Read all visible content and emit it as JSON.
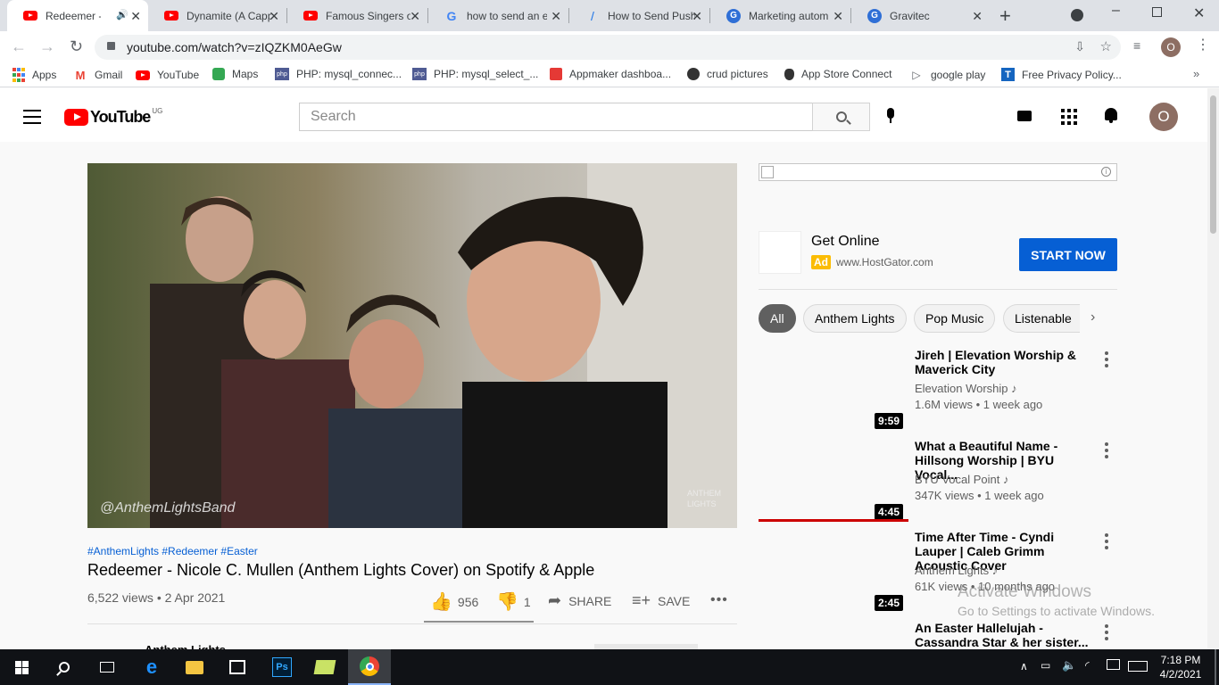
{
  "browser": {
    "tabs": [
      {
        "title": "Redeemer - Nicole C. Mullen",
        "icon": "youtube-icon",
        "active": true
      },
      {
        "title": "Dynamite (A Cappella)",
        "icon": "youtube-icon"
      },
      {
        "title": "Famous Singers of",
        "icon": "youtube-icon"
      },
      {
        "title": "how to send an e",
        "icon": "google-icon"
      },
      {
        "title": "How to Send Push",
        "icon": "page-icon"
      },
      {
        "title": "Marketing autom",
        "icon": "gravitec-icon"
      },
      {
        "title": "Gravitec",
        "icon": "gravitec-icon"
      }
    ],
    "url": "youtube.com/watch?v=zIQZKM0AeGw",
    "profile_initial": "O",
    "bookmarks": [
      {
        "label": "Apps",
        "icon": "apps-icon"
      },
      {
        "label": "Gmail",
        "icon": "gmail-icon"
      },
      {
        "label": "YouTube",
        "icon": "youtube-icon"
      },
      {
        "label": "Maps",
        "icon": "maps-icon"
      },
      {
        "label": "PHP: mysql_connec...",
        "icon": "php-icon"
      },
      {
        "label": "PHP: mysql_select_...",
        "icon": "php-icon"
      },
      {
        "label": "Appmaker dashboa...",
        "icon": "appmaker-icon"
      },
      {
        "label": "crud pictures",
        "icon": "crud-icon"
      },
      {
        "label": "App Store Connect",
        "icon": "apple-icon"
      },
      {
        "label": "google play",
        "icon": "play-icon"
      },
      {
        "label": "Free Privacy Policy...",
        "icon": "termly-icon"
      }
    ]
  },
  "youtube": {
    "logo_text": "YouTube",
    "country": "UG",
    "search_placeholder": "Search",
    "avatar_initial": "O",
    "video": {
      "watermark": "@AnthemLightsBand",
      "corner_logo": "ANTHEM LIGHTS",
      "hashtags": "#AnthemLights #Redeemer #Easter",
      "title": "Redeemer - Nicole C. Mullen (Anthem Lights Cover) on Spotify & Apple",
      "views_date": "6,522 views • 2 Apr 2021",
      "likes": "956",
      "dislikes": "1",
      "share_label": "SHARE",
      "save_label": "SAVE",
      "channel_partial": "Anthem Lights"
    },
    "ad": {
      "title": "Get Online",
      "badge": "Ad",
      "domain": "www.HostGator.com",
      "cta": "START NOW",
      "info": "i"
    },
    "chips": [
      "All",
      "Anthem Lights",
      "Pop Music",
      "Listenable"
    ],
    "related": [
      {
        "title": "Jireh | Elevation Worship & Maverick City",
        "channel": "Elevation Worship",
        "meta": "1.6M views • 1 week ago",
        "duration": "9:59"
      },
      {
        "title": "What a Beautiful Name - Hillsong Worship | BYU Vocal...",
        "channel": "BYU Vocal Point",
        "meta": "347K views • 1 week ago",
        "duration": "4:45",
        "progress": 1.0
      },
      {
        "title": "Time After Time - Cyndi Lauper | Caleb Grimm Acoustic Cover",
        "channel": "Anthem Lights",
        "meta": "61K views • 10 months ago",
        "duration": "2:45"
      },
      {
        "title": "An Easter Hallelujah - Cassandra Star & her sister...",
        "channel": "",
        "meta": "",
        "duration": ""
      }
    ]
  },
  "watermark": {
    "line1": "Activate Windows",
    "line2": "Go to Settings to activate Windows."
  },
  "taskbar": {
    "time": "7:18 PM",
    "date": "4/2/2021"
  }
}
